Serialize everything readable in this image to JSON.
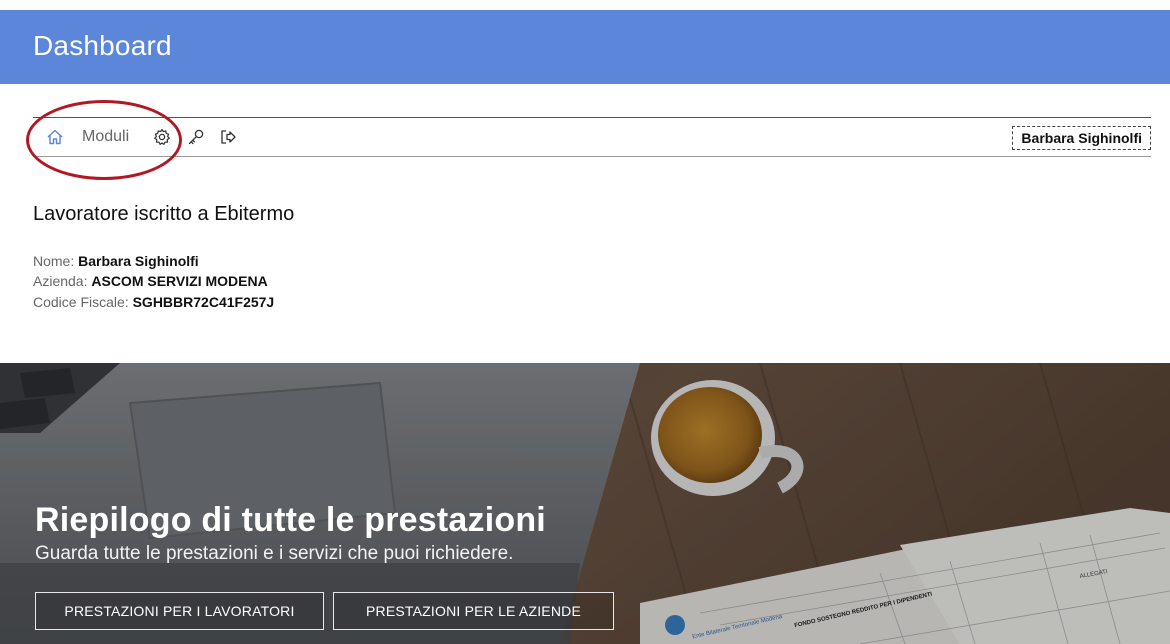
{
  "header": {
    "title": "Dashboard",
    "color": "#5b86d9"
  },
  "toolbar": {
    "home_icon": "home-icon",
    "moduli_label": "Moduli",
    "settings_icon": "gear-icon",
    "key_icon": "key-icon",
    "logout_icon": "logout-icon",
    "user_name": "Barbara Sighinolfi",
    "highlight_color": "#b01822"
  },
  "worker": {
    "title": "Lavoratore iscritto a Ebitermo",
    "nome_label": "Nome:",
    "nome_value": "Barbara Sighinolfi",
    "azienda_label": "Azienda:",
    "azienda_value": "ASCOM SERVIZI MODENA",
    "cf_label": "Codice Fiscale:",
    "cf_value": "SGHBBR72C41F257J"
  },
  "hero": {
    "title": "Riepilogo di tutte le prestazioni",
    "subtitle": "Guarda tutte le prestazioni e i servizi che puoi richiedere.",
    "btn_workers": "PRESTAZIONI PER I LAVORATORI",
    "btn_companies": "PRESTAZIONI PER LE AZIENDE",
    "doc_heading": "FONDO SOSTEGNO REDDITO PER I DIPENDENTI",
    "doc_org": "Ente Bilaterale Territoriale Modena",
    "doc_col": "ALLEGATI"
  }
}
